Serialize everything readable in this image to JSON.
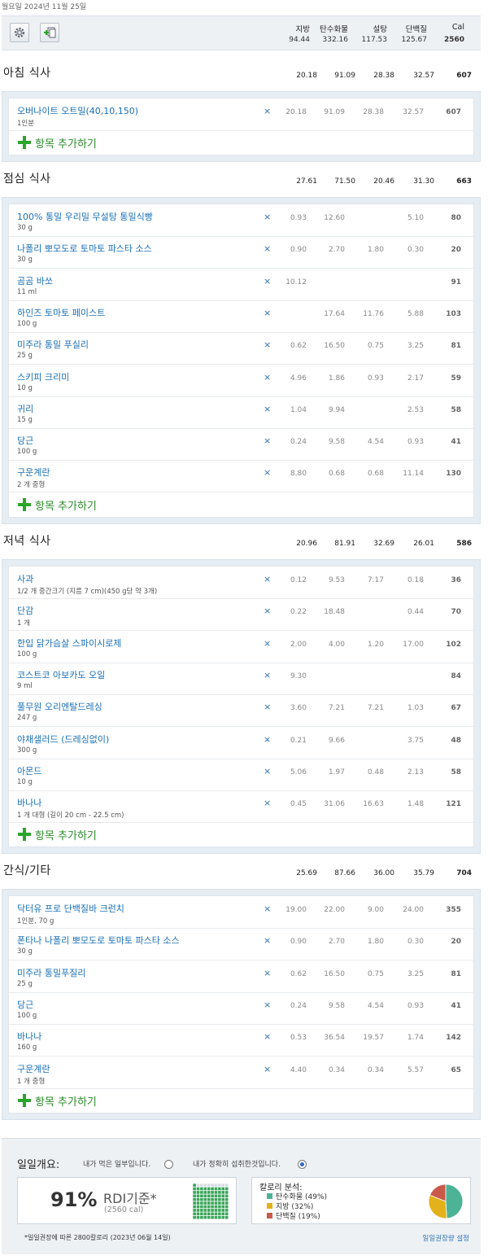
{
  "date": "월요일 2024년 11월 25일",
  "toolbar": {
    "settings_icon": "gear-icon",
    "add_icon": "add-document-icon"
  },
  "header": {
    "labels": {
      "fat": "지방",
      "carb": "탄수화물",
      "sugar": "설탕",
      "protein": "단백질",
      "cal": "Cal"
    },
    "totals": {
      "fat": "94.44",
      "carb": "332.16",
      "sugar": "117.53",
      "protein": "125.67",
      "cal": "2560"
    }
  },
  "add_item_label": "항목 추가하기",
  "remove_symbol": "×",
  "meals": [
    {
      "title": "아침 식사",
      "totals": {
        "fat": "20.18",
        "carb": "91.09",
        "sugar": "28.38",
        "protein": "32.57",
        "cal": "607"
      },
      "items": [
        {
          "name": "오버나이트 오트밀(40,10,150)",
          "qty": "1인분",
          "fat": "20.18",
          "carb": "91.09",
          "sugar": "28.38",
          "protein": "32.57",
          "cal": "607"
        }
      ]
    },
    {
      "title": "점심 식사",
      "totals": {
        "fat": "27.61",
        "carb": "71.50",
        "sugar": "20.46",
        "protein": "31.30",
        "cal": "663"
      },
      "items": [
        {
          "name": "100% 통밀 우리밀 무설탕 통밀식빵",
          "qty": "30 g",
          "fat": "0.93",
          "carb": "12.60",
          "sugar": "",
          "protein": "5.10",
          "cal": "80"
        },
        {
          "name": "나폴리 뽀모도로 토마토 파스타 소스",
          "qty": "30 g",
          "fat": "0.90",
          "carb": "2.70",
          "sugar": "1.80",
          "protein": "0.30",
          "cal": "20"
        },
        {
          "name": "곰곰 바쏘",
          "qty": "11 ml",
          "fat": "10.12",
          "carb": "",
          "sugar": "",
          "protein": "",
          "cal": "91"
        },
        {
          "name": "하인즈 토마토 페이스트",
          "qty": "100 g",
          "fat": "",
          "carb": "17.64",
          "sugar": "11.76",
          "protein": "5.88",
          "cal": "103"
        },
        {
          "name": "미주라 통밀 푸실리",
          "qty": "25 g",
          "fat": "0.62",
          "carb": "16.50",
          "sugar": "0.75",
          "protein": "3.25",
          "cal": "81"
        },
        {
          "name": "스키피 크리미",
          "qty": "10 g",
          "fat": "4.96",
          "carb": "1.86",
          "sugar": "0.93",
          "protein": "2.17",
          "cal": "59"
        },
        {
          "name": "귀리",
          "qty": "15 g",
          "fat": "1.04",
          "carb": "9.94",
          "sugar": "",
          "protein": "2.53",
          "cal": "58"
        },
        {
          "name": "당근",
          "qty": "100 g",
          "fat": "0.24",
          "carb": "9.58",
          "sugar": "4.54",
          "protein": "0.93",
          "cal": "41"
        },
        {
          "name": "구운계란",
          "qty": "2 개 중형",
          "fat": "8.80",
          "carb": "0.68",
          "sugar": "0.68",
          "protein": "11.14",
          "cal": "130"
        }
      ]
    },
    {
      "title": "저녁 식사",
      "totals": {
        "fat": "20.96",
        "carb": "81.91",
        "sugar": "32.69",
        "protein": "26.01",
        "cal": "586"
      },
      "items": [
        {
          "name": "사과",
          "qty": "1/2 개 중간크기 (지름 7 cm)(450 g당 약 3개)",
          "fat": "0.12",
          "carb": "9.53",
          "sugar": "7.17",
          "protein": "0.18",
          "cal": "36"
        },
        {
          "name": "단감",
          "qty": "1 개",
          "fat": "0.22",
          "carb": "18.48",
          "sugar": "",
          "protein": "0.44",
          "cal": "70"
        },
        {
          "name": "한입 닭가슴살 스파이시로제",
          "qty": "100 g",
          "fat": "2.00",
          "carb": "4.00",
          "sugar": "1.20",
          "protein": "17.00",
          "cal": "102"
        },
        {
          "name": "코스트코 아보카도 오일",
          "qty": "9 ml",
          "fat": "9.30",
          "carb": "",
          "sugar": "",
          "protein": "",
          "cal": "84"
        },
        {
          "name": "풀무원 오리엔탈드레싱",
          "qty": "247 g",
          "fat": "3.60",
          "carb": "7.21",
          "sugar": "7.21",
          "protein": "1.03",
          "cal": "67"
        },
        {
          "name": "야채샐러드 (드레싱없이)",
          "qty": "300 g",
          "fat": "0.21",
          "carb": "9.66",
          "sugar": "",
          "protein": "3.75",
          "cal": "48"
        },
        {
          "name": "아몬드",
          "qty": "10 g",
          "fat": "5.06",
          "carb": "1.97",
          "sugar": "0.48",
          "protein": "2.13",
          "cal": "58"
        },
        {
          "name": "바나나",
          "qty": "1 개 대형 (길이 20 cm - 22.5 cm)",
          "fat": "0.45",
          "carb": "31.06",
          "sugar": "16.63",
          "protein": "1.48",
          "cal": "121"
        }
      ]
    },
    {
      "title": "간식/기타",
      "totals": {
        "fat": "25.69",
        "carb": "87.66",
        "sugar": "36.00",
        "protein": "35.79",
        "cal": "704"
      },
      "items": [
        {
          "name": "닥터유 프로 단백질바 크런치",
          "qty": "1인분, 70 g",
          "fat": "19.00",
          "carb": "22.00",
          "sugar": "9.00",
          "protein": "24.00",
          "cal": "355"
        },
        {
          "name": "폰타나 나폴리 뽀모도로 토마토 파스타 소스",
          "qty": "30 g",
          "fat": "0.90",
          "carb": "2.70",
          "sugar": "1.80",
          "protein": "0.30",
          "cal": "20"
        },
        {
          "name": "미주라 통밀푸질리",
          "qty": "25 g",
          "fat": "0.62",
          "carb": "16.50",
          "sugar": "0.75",
          "protein": "3.25",
          "cal": "81"
        },
        {
          "name": "당근",
          "qty": "100 g",
          "fat": "0.24",
          "carb": "9.58",
          "sugar": "4.54",
          "protein": "0.93",
          "cal": "41"
        },
        {
          "name": "바나나",
          "qty": "160 g",
          "fat": "0.53",
          "carb": "36.54",
          "sugar": "19.57",
          "protein": "1.74",
          "cal": "142"
        },
        {
          "name": "구운계란",
          "qty": "1 개 중형",
          "fat": "4.40",
          "carb": "0.34",
          "sugar": "0.34",
          "protein": "5.57",
          "cal": "65"
        }
      ]
    }
  ],
  "summary": {
    "title": "일일개요:",
    "option_partial": "내가 먹은 일부입니다.",
    "option_exact": "내가 정확히 섭취한것입니다.",
    "selected_option": "exact",
    "rdi_percent": "91%",
    "rdi_label": "RDI기준*",
    "rdi_cal": "(2560 cal)",
    "rdi_fraction": 0.91,
    "breakdown_title": "칼로리 분석:",
    "breakdown": [
      {
        "label": "탄수화물 (49%)",
        "pct": 49,
        "color": "#4db396"
      },
      {
        "label": "지방 (32%)",
        "pct": 32,
        "color": "#e3b21b"
      },
      {
        "label": "단백질 (19%)",
        "pct": 19,
        "color": "#c95a4a"
      }
    ],
    "footnote": "*일일권장에 따른 2800칼로리 (2023년 06월 14일)",
    "rdi_link": "일일권장량 설정"
  }
}
